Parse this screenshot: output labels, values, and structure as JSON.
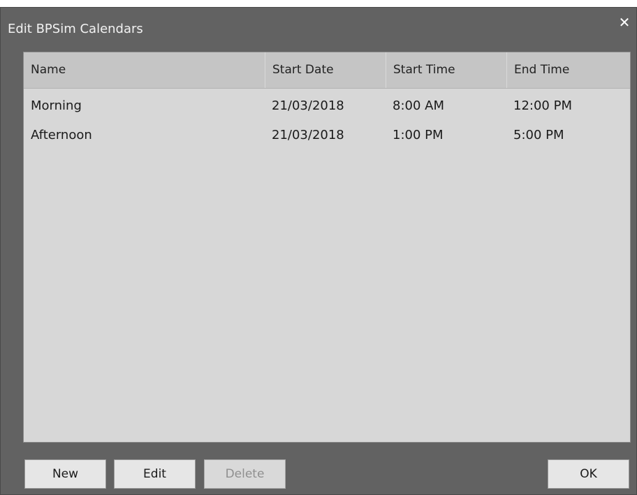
{
  "window": {
    "title": "Edit BPSim Calendars",
    "close_glyph": "✕"
  },
  "table": {
    "columns": [
      "Name",
      "Start Date",
      "Start Time",
      "End Time"
    ],
    "rows": [
      {
        "name": "Morning",
        "start_date": "21/03/2018",
        "start_time": "8:00 AM",
        "end_time": "12:00 PM"
      },
      {
        "name": "Afternoon",
        "start_date": "21/03/2018",
        "start_time": "1:00 PM",
        "end_time": "5:00 PM"
      }
    ]
  },
  "buttons": {
    "new": "New",
    "edit": "Edit",
    "delete": "Delete",
    "ok": "OK"
  },
  "colors": {
    "dialog_bg": "#626262",
    "list_bg": "#d7d7d7",
    "header_bg": "#c5c5c5"
  }
}
